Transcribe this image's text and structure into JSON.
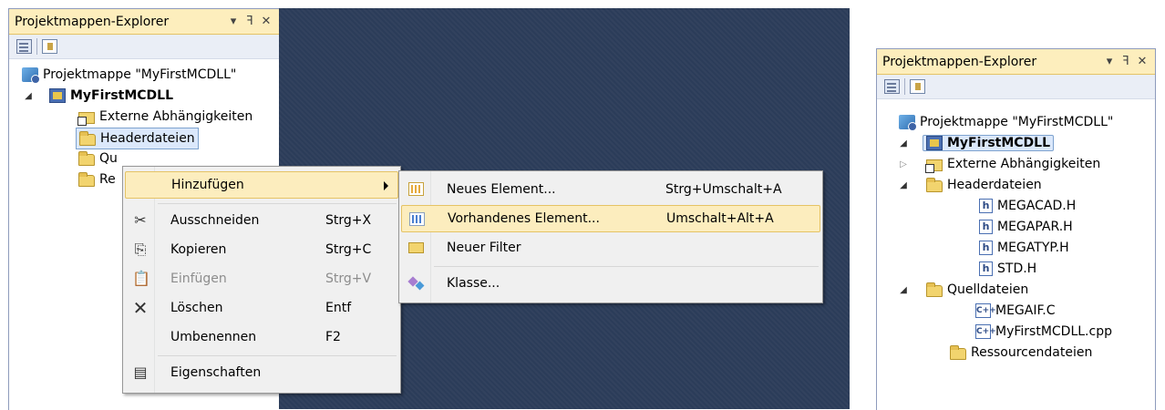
{
  "left_explorer": {
    "title": "Projektmappen-Explorer",
    "ctrl_dropdown": "▾",
    "ctrl_pin": "ꟻ",
    "ctrl_close": "✕",
    "solution": "Projektmappe \"MyFirstMCDLL\"",
    "project": "MyFirstMCDLL",
    "items": [
      "Externe Abhängigkeiten",
      "Headerdateien",
      "Qu",
      "Re"
    ]
  },
  "context_menu": {
    "items": [
      {
        "label": "Hinzufügen",
        "shortcut": ""
      },
      {
        "label": "Ausschneiden",
        "shortcut": "Strg+X"
      },
      {
        "label": "Kopieren",
        "shortcut": "Strg+C"
      },
      {
        "label": "Einfügen",
        "shortcut": "Strg+V"
      },
      {
        "label": "Löschen",
        "shortcut": "Entf"
      },
      {
        "label": "Umbenennen",
        "shortcut": "F2"
      },
      {
        "label": "Eigenschaften",
        "shortcut": ""
      }
    ]
  },
  "submenu": {
    "items": [
      {
        "label": "Neues Element...",
        "shortcut": "Strg+Umschalt+A"
      },
      {
        "label": "Vorhandenes Element...",
        "shortcut": "Umschalt+Alt+A"
      },
      {
        "label": "Neuer Filter",
        "shortcut": ""
      },
      {
        "label": "Klasse...",
        "shortcut": ""
      }
    ]
  },
  "right_explorer": {
    "title": "Projektmappen-Explorer",
    "ctrl_dropdown": "▾",
    "ctrl_pin": "ꟻ",
    "ctrl_close": "✕",
    "solution": "Projektmappe \"MyFirstMCDLL\"",
    "project": "MyFirstMCDLL",
    "ext_deps": "Externe Abhängigkeiten",
    "header_folder": "Headerdateien",
    "headers": [
      "MEGACAD.H",
      "MEGAPAR.H",
      "MEGATYP.H",
      "STD.H"
    ],
    "source_folder": "Quelldateien",
    "sources": [
      "MEGAIF.C",
      "MyFirstMCDLL.cpp"
    ],
    "resource_folder": "Ressourcendateien",
    "h_icon_letter": "h",
    "c_icon_letter": "C++"
  },
  "colors": {
    "title_bg": "#fdeebd",
    "menu_highlight": "#fcedbe",
    "background_dark": "#2b3c59"
  }
}
